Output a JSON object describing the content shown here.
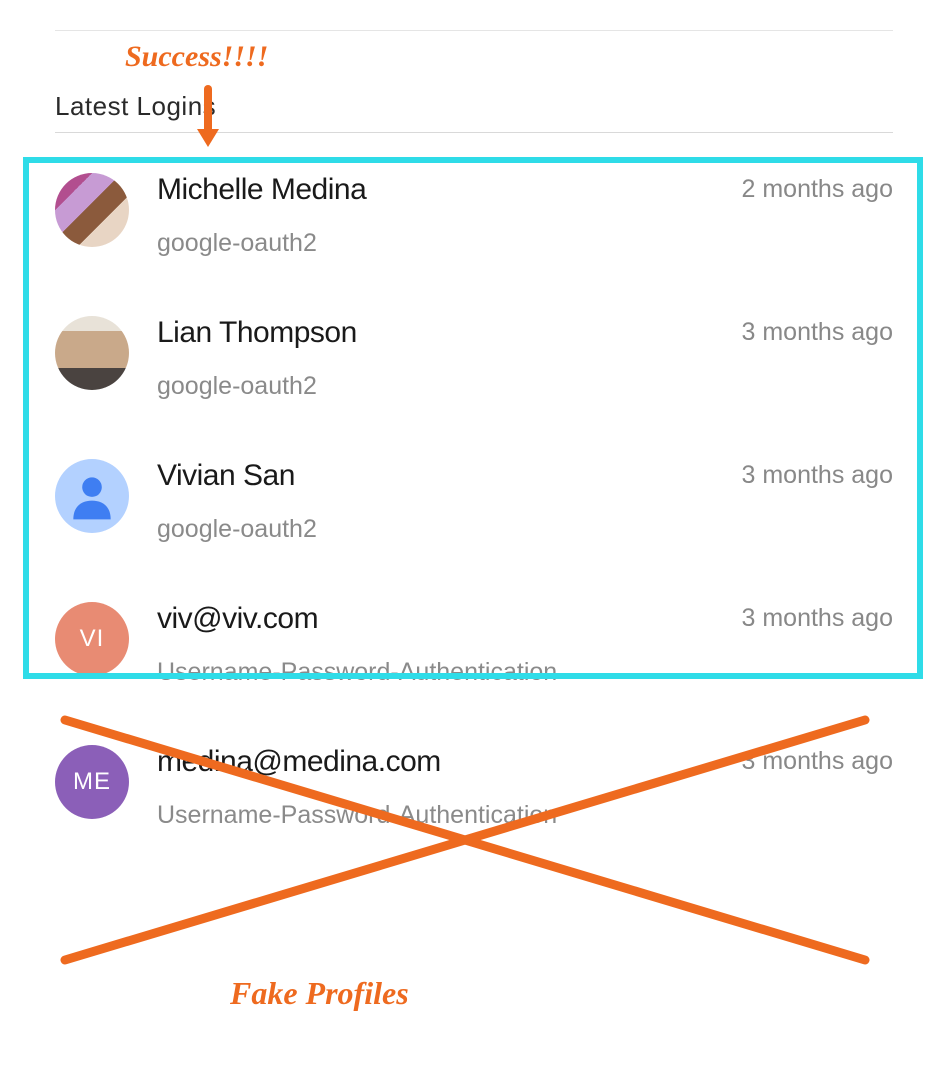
{
  "section": {
    "title": "Latest Logins"
  },
  "logins": [
    {
      "name": "Michelle Medina",
      "provider": "google-oauth2",
      "time": "2 months ago",
      "avatar_type": "photo1"
    },
    {
      "name": "Lian Thompson",
      "provider": "google-oauth2",
      "time": "3 months ago",
      "avatar_type": "photo2"
    },
    {
      "name": "Vivian San",
      "provider": "google-oauth2",
      "time": "3 months ago",
      "avatar_type": "default"
    },
    {
      "name": "viv@viv.com",
      "provider": "Username-Password-Authentication",
      "time": "3 months ago",
      "avatar_type": "initials",
      "initials": "VI",
      "color": "coral"
    },
    {
      "name": "medina@medina.com",
      "provider": "Username-Password-Authentication",
      "time": "3 months ago",
      "avatar_type": "initials",
      "initials": "ME",
      "color": "purple"
    }
  ],
  "annotations": {
    "success": "Success!!!!",
    "fake": "Fake Profiles"
  },
  "colors": {
    "highlight": "#2fdce8",
    "annotation": "#ee6a1f"
  }
}
